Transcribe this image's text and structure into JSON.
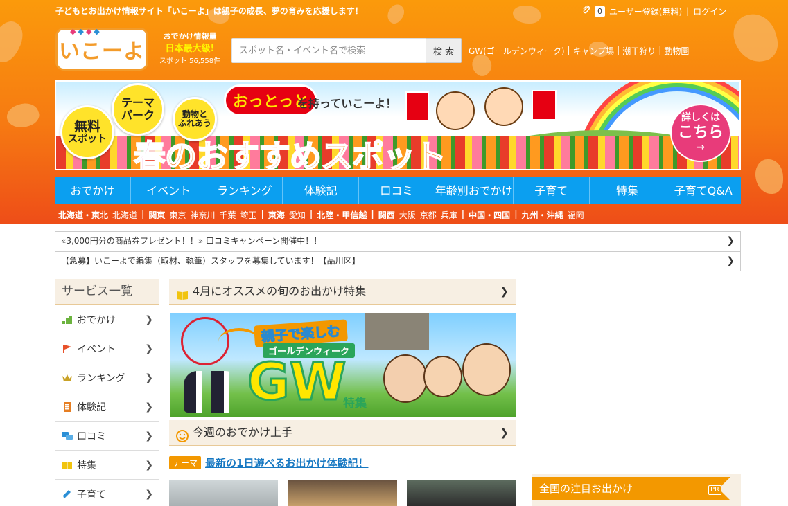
{
  "header": {
    "tagline": "子どもとお出かけ情報サイト「いこーよ」は親子の成長、夢の育みを応援します！",
    "clip_count": "0",
    "register_label": "ユーザー登録(無料)",
    "separator": "|",
    "login_label": "ログイン",
    "logo_text": "いこーよ",
    "info_line1": "おでかけ情報量",
    "info_line2": "日本最大級!",
    "info_line3": "スポット 56,558件",
    "search_placeholder": "スポット名・イベント名で検索",
    "search_button": "検 索",
    "quick_links": [
      "GW(ゴールデンウィーク)",
      "キャンプ場",
      "潮干狩り",
      "動物園"
    ]
  },
  "banner": {
    "badge_free_line1": "無料",
    "badge_free_line2": "スポット",
    "badge_theme_line1": "テーマ",
    "badge_theme_line2": "パーク",
    "badge_animal_line1": "動物と",
    "badge_animal_line2": "ふれあう",
    "brand": "おっとっと",
    "slogan": "を持っていこーよ！",
    "title_pre": "春",
    "title_post": "のおすすめスポット",
    "details_line1": "詳しくは",
    "details_line2": "こちら",
    "details_arrow": "→"
  },
  "nav": {
    "items": [
      "おでかけ",
      "イベント",
      "ランキング",
      "体験記",
      "口コミ",
      "年齢別おでかけ",
      "子育て",
      "特集",
      "子育てQ&A"
    ]
  },
  "regions": [
    {
      "region": "北海道・東北",
      "prefs": [
        "北海道"
      ]
    },
    {
      "region": "関東",
      "prefs": [
        "東京",
        "神奈川",
        "千葉",
        "埼玉"
      ]
    },
    {
      "region": "東海",
      "prefs": [
        "愛知"
      ]
    },
    {
      "region": "北陸・甲信越",
      "prefs": []
    },
    {
      "region": "関西",
      "prefs": [
        "大阪",
        "京都",
        "兵庫"
      ]
    },
    {
      "region": "中国・四国",
      "prefs": []
    },
    {
      "region": "九州・沖縄",
      "prefs": [
        "福岡"
      ]
    }
  ],
  "notices": [
    "«3,000円分の商品券プレゼント！！» 口コミキャンペーン開催中！！",
    "【急募】いこーよで編集（取材、執筆）スタッフを募集しています！【品川区】"
  ],
  "sidebar": {
    "heading": "サービス一覧",
    "items": [
      {
        "label": "おでかけ",
        "icon": "map-icon",
        "color": "#6cb33f"
      },
      {
        "label": "イベント",
        "icon": "flag-icon",
        "color": "#e8512a"
      },
      {
        "label": "ランキング",
        "icon": "crown-icon",
        "color": "#c9a227"
      },
      {
        "label": "体験記",
        "icon": "notebook-icon",
        "color": "#e67e22"
      },
      {
        "label": "口コミ",
        "icon": "chat-bubbles-icon",
        "color": "#2b8fd6"
      },
      {
        "label": "特集",
        "icon": "book-icon",
        "color": "#f1c40f"
      },
      {
        "label": "子育て",
        "icon": "pencil-icon",
        "color": "#2b8fd6"
      }
    ]
  },
  "main": {
    "feature_heading": "4月にオススメの旬のお出かけ特集",
    "gw_title": "親子で楽しむ",
    "gw_subtitle": "ゴールデンウィーク",
    "gw_big": "GW",
    "gw_tokushu": "特集",
    "weekly_heading": "今週のおでかけ上手",
    "theme_tag": "テーマ",
    "theme_link": "最新の1日遊べるお出かけ体験記！"
  },
  "pr_box": {
    "heading": "全国の注目お出かけ",
    "pr_label": "PR"
  },
  "colors": {
    "header_orange": "#f67a12",
    "nav_blue": "#0b9ff0",
    "accent_orange": "#f39800",
    "link_blue": "#1678c2"
  }
}
